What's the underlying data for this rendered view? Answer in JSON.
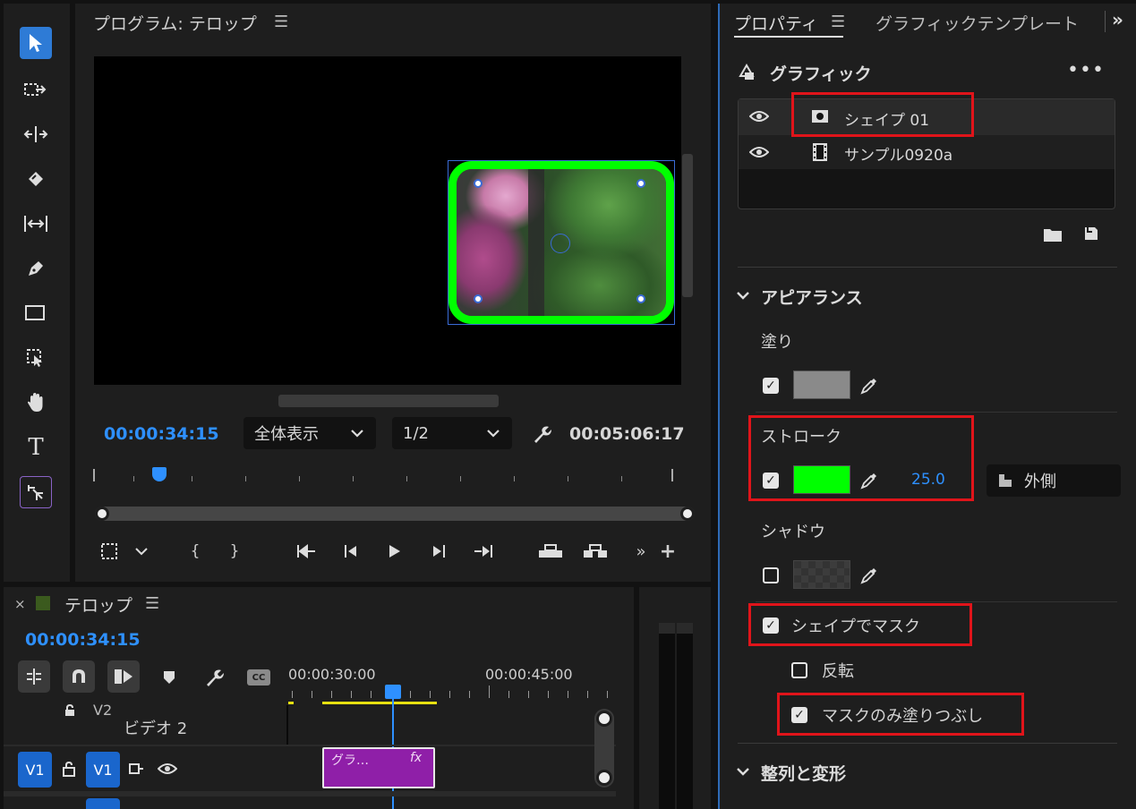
{
  "program_monitor": {
    "title": "プログラム: テロップ",
    "current_time": "00:00:34:15",
    "zoom_select": "全体表示",
    "resolution_select": "1/2",
    "duration": "00:05:06:17"
  },
  "timeline": {
    "sequence_name": "テロップ",
    "current_time": "00:00:34:15",
    "ruler_labels": [
      "00:00:30:00",
      "00:00:45:00"
    ],
    "tracks": {
      "v2_label": "V2",
      "v2_name": "ビデオ 2",
      "v1_source": "V1",
      "v1_target": "V1"
    },
    "clip_label": "グラ…",
    "clip_fx": "fx"
  },
  "properties_panel": {
    "tab_properties": "プロパティ",
    "tab_graphic_template": "グラフィックテンプレート",
    "section_graphic": "グラフィック",
    "layers": [
      {
        "name": "シェイプ 01"
      },
      {
        "name": "サンプル0920a"
      }
    ],
    "appearance_title": "アピアランス",
    "fill_label": "塗り",
    "fill_color": "#8a8a8a",
    "stroke_label": "ストローク",
    "stroke_color": "#00ff00",
    "stroke_width": "25.0",
    "stroke_position": "外側",
    "shadow_label": "シャドウ",
    "mask_with_shape": "シェイプでマスク",
    "invert": "反転",
    "fill_mask_only": "マスクのみ塗りつぶし",
    "align_transform_title": "整列と変形"
  },
  "colors": {
    "accent_blue": "#2e90ff",
    "highlight_red": "#e0141a",
    "clip_purple": "#8f1fa8"
  }
}
